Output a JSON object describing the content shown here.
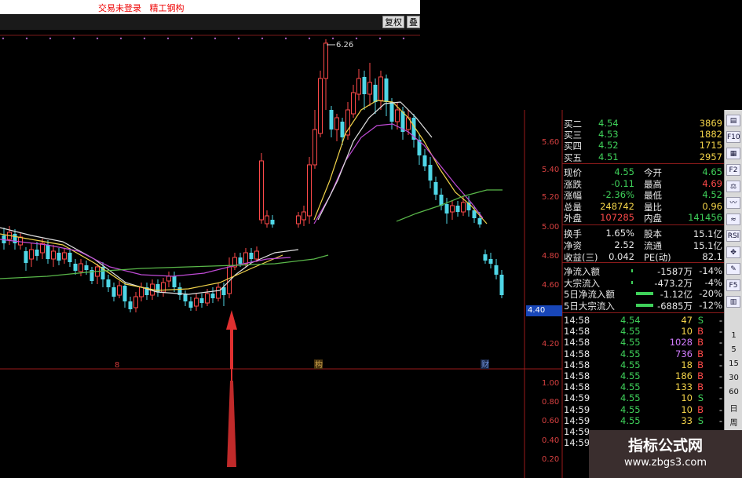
{
  "titlebar": {
    "status_text": "交易未登录",
    "stock_name": "精工钢构"
  },
  "toolbar": {
    "fuquan_label": "复权",
    "die_label": "叠"
  },
  "chart": {
    "peak_label": "6.26",
    "price_box": "4.40",
    "axis_labels": [
      "5.60",
      "5.40",
      "5.20",
      "5.00",
      "4.80",
      "4.60",
      "4.20",
      "1.00",
      "0.80",
      "0.60",
      "0.40",
      "0.20"
    ],
    "markers": [
      {
        "text": "8",
        "color": "#d63a3a"
      },
      {
        "text": "构",
        "color": "#c9a14a"
      },
      {
        "text": "财",
        "color": "#6c8fd9"
      }
    ]
  },
  "quote": {
    "bids": [
      {
        "name": "买二",
        "price": "4.54",
        "vol": "3869"
      },
      {
        "name": "买三",
        "price": "4.53",
        "vol": "1882"
      },
      {
        "name": "买四",
        "price": "4.52",
        "vol": "1715"
      },
      {
        "name": "买五",
        "price": "4.51",
        "vol": "2957"
      }
    ],
    "stats": [
      {
        "k1": "现价",
        "v1": "4.55",
        "c1": "green",
        "k2": "今开",
        "v2": "4.65",
        "c2": "green"
      },
      {
        "k1": "涨跌",
        "v1": "-0.11",
        "c1": "green",
        "k2": "最高",
        "v2": "4.69",
        "c2": "red"
      },
      {
        "k1": "涨幅",
        "v1": "-2.36%",
        "c1": "green",
        "k2": "最低",
        "v2": "4.52",
        "c2": "green"
      },
      {
        "k1": "总量",
        "v1": "248742",
        "c1": "yellow",
        "k2": "量比",
        "v2": "0.96",
        "c2": "yellow"
      },
      {
        "k1": "外盘",
        "v1": "107285",
        "c1": "red",
        "k2": "内盘",
        "v2": "141456",
        "c2": "green"
      }
    ],
    "stats2": [
      {
        "k1": "换手",
        "v1": "1.65%",
        "k2": "股本",
        "v2": "15.1亿"
      },
      {
        "k1": "净资",
        "v1": "2.52",
        "k2": "流通",
        "v2": "15.1亿"
      },
      {
        "k1": "收益(三)",
        "v1": "0.042",
        "k2": "PE(动)",
        "v2": "82.1"
      }
    ],
    "flows": [
      {
        "name": "净流入额",
        "val": "-1587万",
        "pct": "-14%"
      },
      {
        "name": "大宗流入",
        "val": "-473.2万",
        "pct": "-4%"
      },
      {
        "name": "5日净流入额",
        "val": "-1.12亿",
        "pct": "-20%"
      },
      {
        "name": "5日大宗流入",
        "val": "-6885万",
        "pct": "-12%"
      }
    ],
    "ticks": [
      {
        "t": "14:58",
        "p": "4.54",
        "v": "47",
        "s": "S"
      },
      {
        "t": "14:58",
        "p": "4.55",
        "v": "10",
        "s": "B"
      },
      {
        "t": "14:58",
        "p": "4.55",
        "v": "1028",
        "s": "B"
      },
      {
        "t": "14:58",
        "p": "4.55",
        "v": "736",
        "s": "B"
      },
      {
        "t": "14:58",
        "p": "4.55",
        "v": "18",
        "s": "B"
      },
      {
        "t": "14:58",
        "p": "4.55",
        "v": "186",
        "s": "B"
      },
      {
        "t": "14:58",
        "p": "4.55",
        "v": "133",
        "s": "B"
      },
      {
        "t": "14:59",
        "p": "4.55",
        "v": "10",
        "s": "S"
      },
      {
        "t": "14:59",
        "p": "4.55",
        "v": "10",
        "s": "B"
      },
      {
        "t": "14:59",
        "p": "4.55",
        "v": "33",
        "s": "S"
      },
      {
        "t": "14:59",
        "p": "",
        "v": "",
        "s": ""
      },
      {
        "t": "14:59",
        "p": "",
        "v": "",
        "s": ""
      }
    ]
  },
  "sidebar": {
    "icons": [
      "quote-icon",
      "f10-icon",
      "chart-icon",
      "f2-icon",
      "compare-icon",
      "trend-icon",
      "line-icon",
      "rsi-icon",
      "move-icon",
      "pencil-icon",
      "f5-icon",
      "table-icon"
    ],
    "icon_labels": {
      "f10": "F10",
      "f2": "F2",
      "rsi": "RSI",
      "f5": "F5"
    },
    "periods": [
      "1",
      "5",
      "15",
      "30",
      "60",
      "日",
      "周"
    ]
  },
  "watermark": {
    "title": "指标公式网",
    "url": "www.zbgs3.com"
  }
}
